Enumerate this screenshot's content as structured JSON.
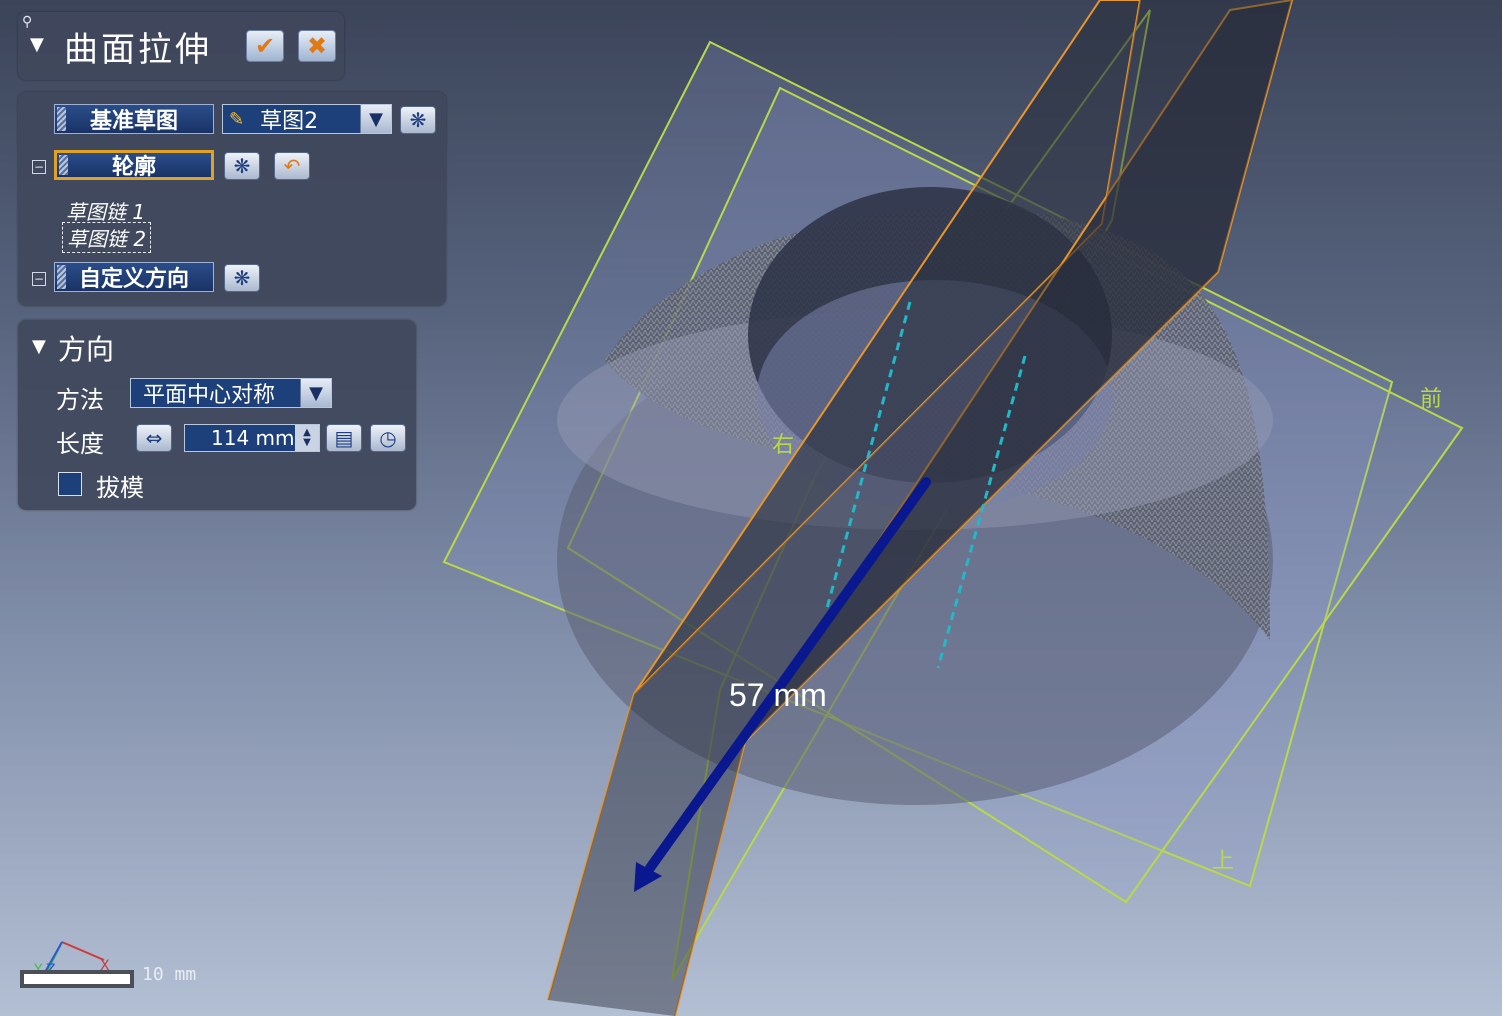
{
  "feature": {
    "title": "曲面拉伸",
    "ok_symbol": "✔",
    "cancel_symbol": "✖"
  },
  "profile_section": {
    "base_sketch_label": "基准草图",
    "sketch_value": "草图2",
    "profile_label": "轮廓",
    "chains": [
      "草图链 1",
      "草图链 2"
    ],
    "custom_direction_label": "自定义方向"
  },
  "direction_section": {
    "header": "方向",
    "method_label": "方法",
    "method_value": "平面中心对称",
    "length_label": "长度",
    "length_value": "114 mm",
    "draft_label": "拔模",
    "draft_checked": false
  },
  "viewport": {
    "dimension_label": "57 mm",
    "plane_labels": {
      "right": "右",
      "front": "前",
      "top": "上"
    },
    "scale_label": "10 mm",
    "axis_labels": {
      "x": "X",
      "y": "Y",
      "z": "Z"
    },
    "colors": {
      "plane_outline": "#b9d949",
      "sheet_outline": "#e8962a",
      "arrow": "#0a1890",
      "dashed_profile": "#23b8c8"
    }
  }
}
